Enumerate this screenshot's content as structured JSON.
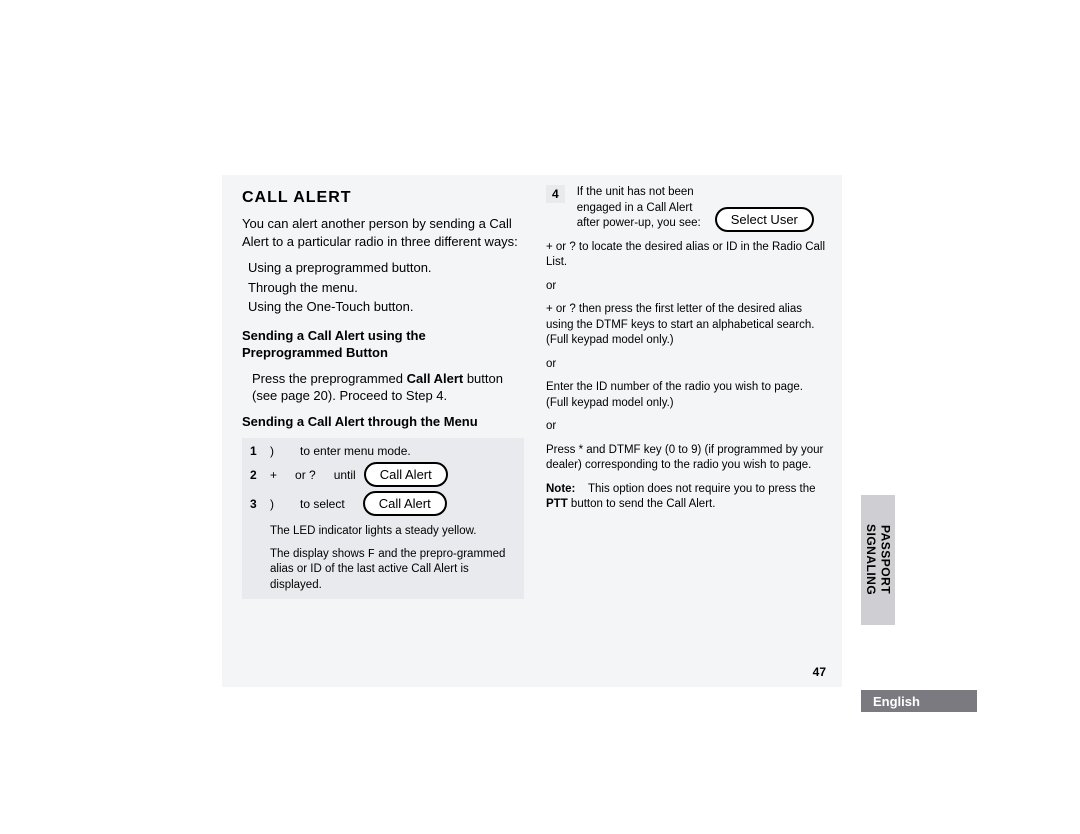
{
  "page_number": "47",
  "side_tab": {
    "line1": "PASSPORT",
    "line2": "SIGNALING"
  },
  "lang": "English",
  "h1": "CALL ALERT",
  "intro": "You can alert another person by sending a Call Alert to a particular radio in three different ways:",
  "ways": [
    "Using a preprogrammed button.",
    "Through the menu.",
    "Using the One-Touch button."
  ],
  "sub1_title": "Sending a Call Alert using the Preprogrammed Button",
  "sub1_body_a": "Press the preprogrammed ",
  "sub1_body_b": "Call Alert",
  "sub1_body_c": " button (see page 20). Proceed to Step 4.",
  "sub2_title": "Sending a Call Alert through the Menu",
  "steps": {
    "s1_num": "1",
    "s1_sym": ")",
    "s1_txt": "to enter menu mode.",
    "s2_num": "2",
    "s2_a": "+",
    "s2_b": "or ?",
    "s2_c": "until",
    "s2_chip": "Call Alert",
    "s3_num": "3",
    "s3_sym": ")",
    "s3_txt": "to select",
    "s3_chip": "Call Alert",
    "led": "The LED indicator lights a steady yellow.",
    "disp_a": "The display shows ",
    "disp_f": "F",
    "disp_b": " and the prepro-grammed alias or ID of the last active Call Alert is displayed."
  },
  "right": {
    "s4_num": "4",
    "s4_a": "If the unit has not been engaged in a Call Alert after power-up, you see:",
    "s4_chip": "Select User",
    "opt1": "+       or ?       to locate the desired alias or ID in the Radio Call List.",
    "or": "or",
    "opt2": "+       or ?       then press the first letter of the desired alias using the DTMF keys to start an alphabetical search. (Full keypad model only.)",
    "opt3": "Enter the ID number of the radio you wish to page. (Full keypad model only.)",
    "opt4": "Press * and DTMF key (0 to 9) (if programmed by your dealer) corresponding to the radio you wish to page.",
    "note_lbl": "Note:",
    "note_a": "This option does not require you to press the ",
    "note_ptt": "PTT",
    "note_b": " button to send the Call Alert."
  }
}
